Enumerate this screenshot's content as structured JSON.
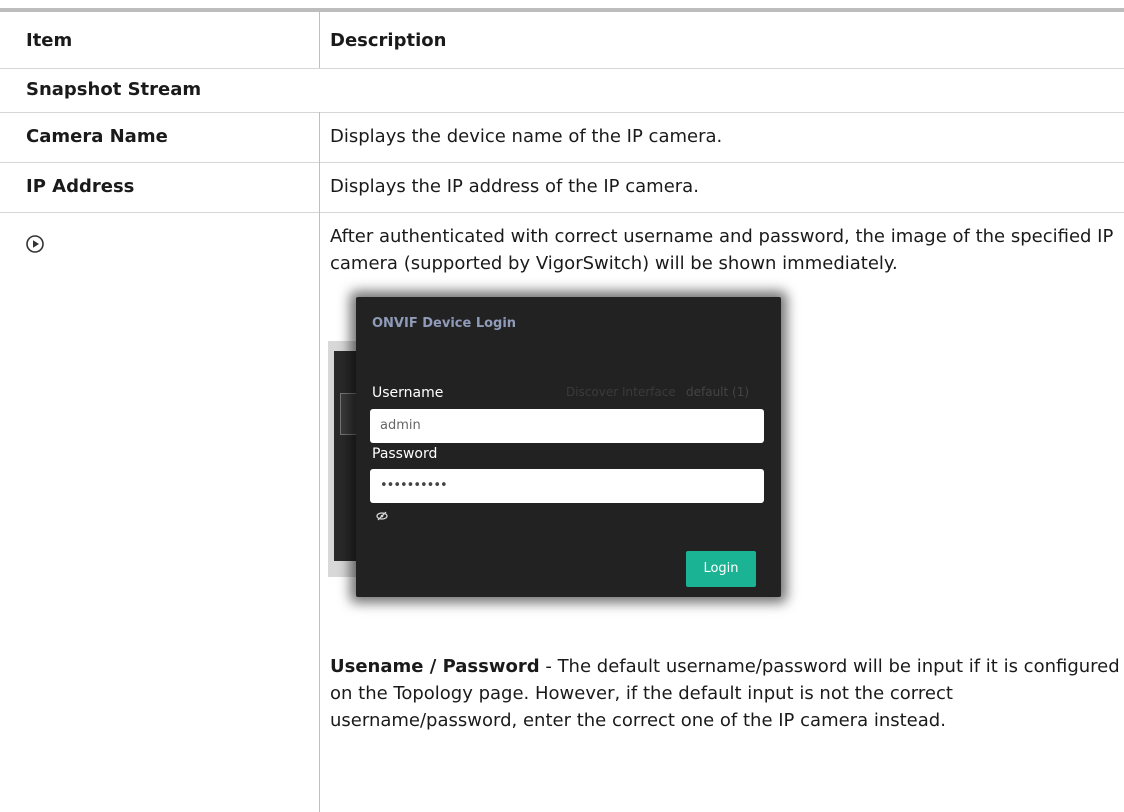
{
  "table": {
    "header": {
      "item": "Item",
      "description": "Description"
    },
    "section_title": "Snapshot Stream",
    "rows": [
      {
        "item": "Camera Name",
        "description": "Displays the device name of the IP camera."
      },
      {
        "item": "IP Address",
        "description": "Displays the IP address of the IP camera."
      }
    ],
    "play_row": {
      "icon": "play-circle-icon",
      "description": "After authenticated with correct username and password, the image of the specified IP camera (supported by VigorSwitch) will be shown immediately.",
      "note_bold": "Usename / Password",
      "note_text": " - The default username/password will be input if it is configured on the Topology page. However, if the default input is not the correct username/password, enter the correct one of the IP camera instead."
    }
  },
  "onvif_dialog": {
    "title": "ONVIF Device Login",
    "faint_left": "Discover Interface",
    "faint_right": "default (1)",
    "username_label": "Username",
    "username_value": "admin",
    "password_label": "Password",
    "password_value": "••••••••••",
    "eye_icon": "eye-slash-icon",
    "login_label": "Login",
    "login_color": "#1ab394"
  }
}
